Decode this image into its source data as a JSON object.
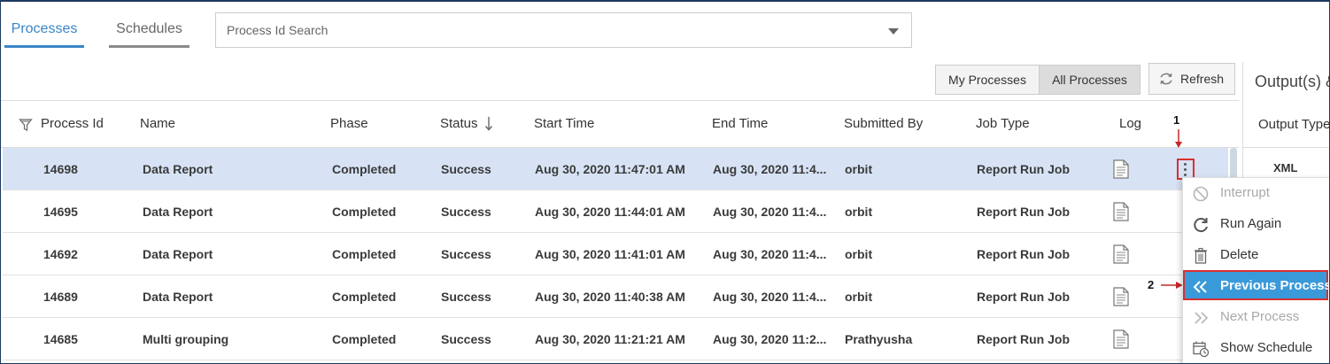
{
  "tabs": [
    {
      "label": "Processes",
      "active": true
    },
    {
      "label": "Schedules",
      "active": false
    }
  ],
  "search": {
    "placeholder": "Process Id Search"
  },
  "toggle": {
    "my_label": "My Processes",
    "all_label": "All Processes",
    "selected": "All Processes"
  },
  "refresh": {
    "label": "Refresh",
    "icon": "refresh-icon"
  },
  "columns": [
    "Process Id",
    "Name",
    "Phase",
    "Status",
    "Start Time",
    "End Time",
    "Submitted By",
    "Job Type",
    "Log"
  ],
  "rows": [
    {
      "id": "14698",
      "name": "Data Report",
      "phase": "Completed",
      "status": "Success",
      "start": "Aug 30, 2020 11:47:01 AM",
      "end": "Aug 30, 2020 11:4...",
      "by": "orbit",
      "type": "Report Run Job",
      "selected": true
    },
    {
      "id": "14695",
      "name": "Data Report",
      "phase": "Completed",
      "status": "Success",
      "start": "Aug 30, 2020 11:44:01 AM",
      "end": "Aug 30, 2020 11:4...",
      "by": "orbit",
      "type": "Report Run Job",
      "selected": false
    },
    {
      "id": "14692",
      "name": "Data Report",
      "phase": "Completed",
      "status": "Success",
      "start": "Aug 30, 2020 11:41:01 AM",
      "end": "Aug 30, 2020 11:4...",
      "by": "orbit",
      "type": "Report Run Job",
      "selected": false
    },
    {
      "id": "14689",
      "name": "Data Report",
      "phase": "Completed",
      "status": "Success",
      "start": "Aug 30, 2020 11:40:38 AM",
      "end": "Aug 30, 2020 11:4...",
      "by": "orbit",
      "type": "Report Run Job",
      "selected": false
    },
    {
      "id": "14685",
      "name": "Multi grouping",
      "phase": "Completed",
      "status": "Success",
      "start": "Aug 30, 2020 11:21:21 AM",
      "end": "Aug 30, 2020 11:2...",
      "by": "Prathyusha",
      "type": "Report Run Job",
      "selected": false
    }
  ],
  "output_panel": {
    "title": "Output(s) &",
    "column": "Output Type",
    "value": "XML"
  },
  "annotations": {
    "step1": "1",
    "step2": "2"
  },
  "context_menu": [
    {
      "label": "Interrupt",
      "icon": "prohibited-icon",
      "disabled": true
    },
    {
      "label": "Run Again",
      "icon": "rerun-icon",
      "disabled": false
    },
    {
      "label": "Delete",
      "icon": "trash-icon",
      "disabled": false
    },
    {
      "label": "Previous Process",
      "icon": "double-chevron-left-icon",
      "disabled": false,
      "highlighted": true
    },
    {
      "label": "Next Process",
      "icon": "double-chevron-right-icon",
      "disabled": true
    },
    {
      "label": "Show Schedule",
      "icon": "calendar-clock-icon",
      "disabled": false
    }
  ],
  "colors": {
    "accent": "#3a86c8",
    "selected_row": "#d7e3f5",
    "menu_highlight": "#3a9ad9",
    "annotation": "#d93030"
  }
}
